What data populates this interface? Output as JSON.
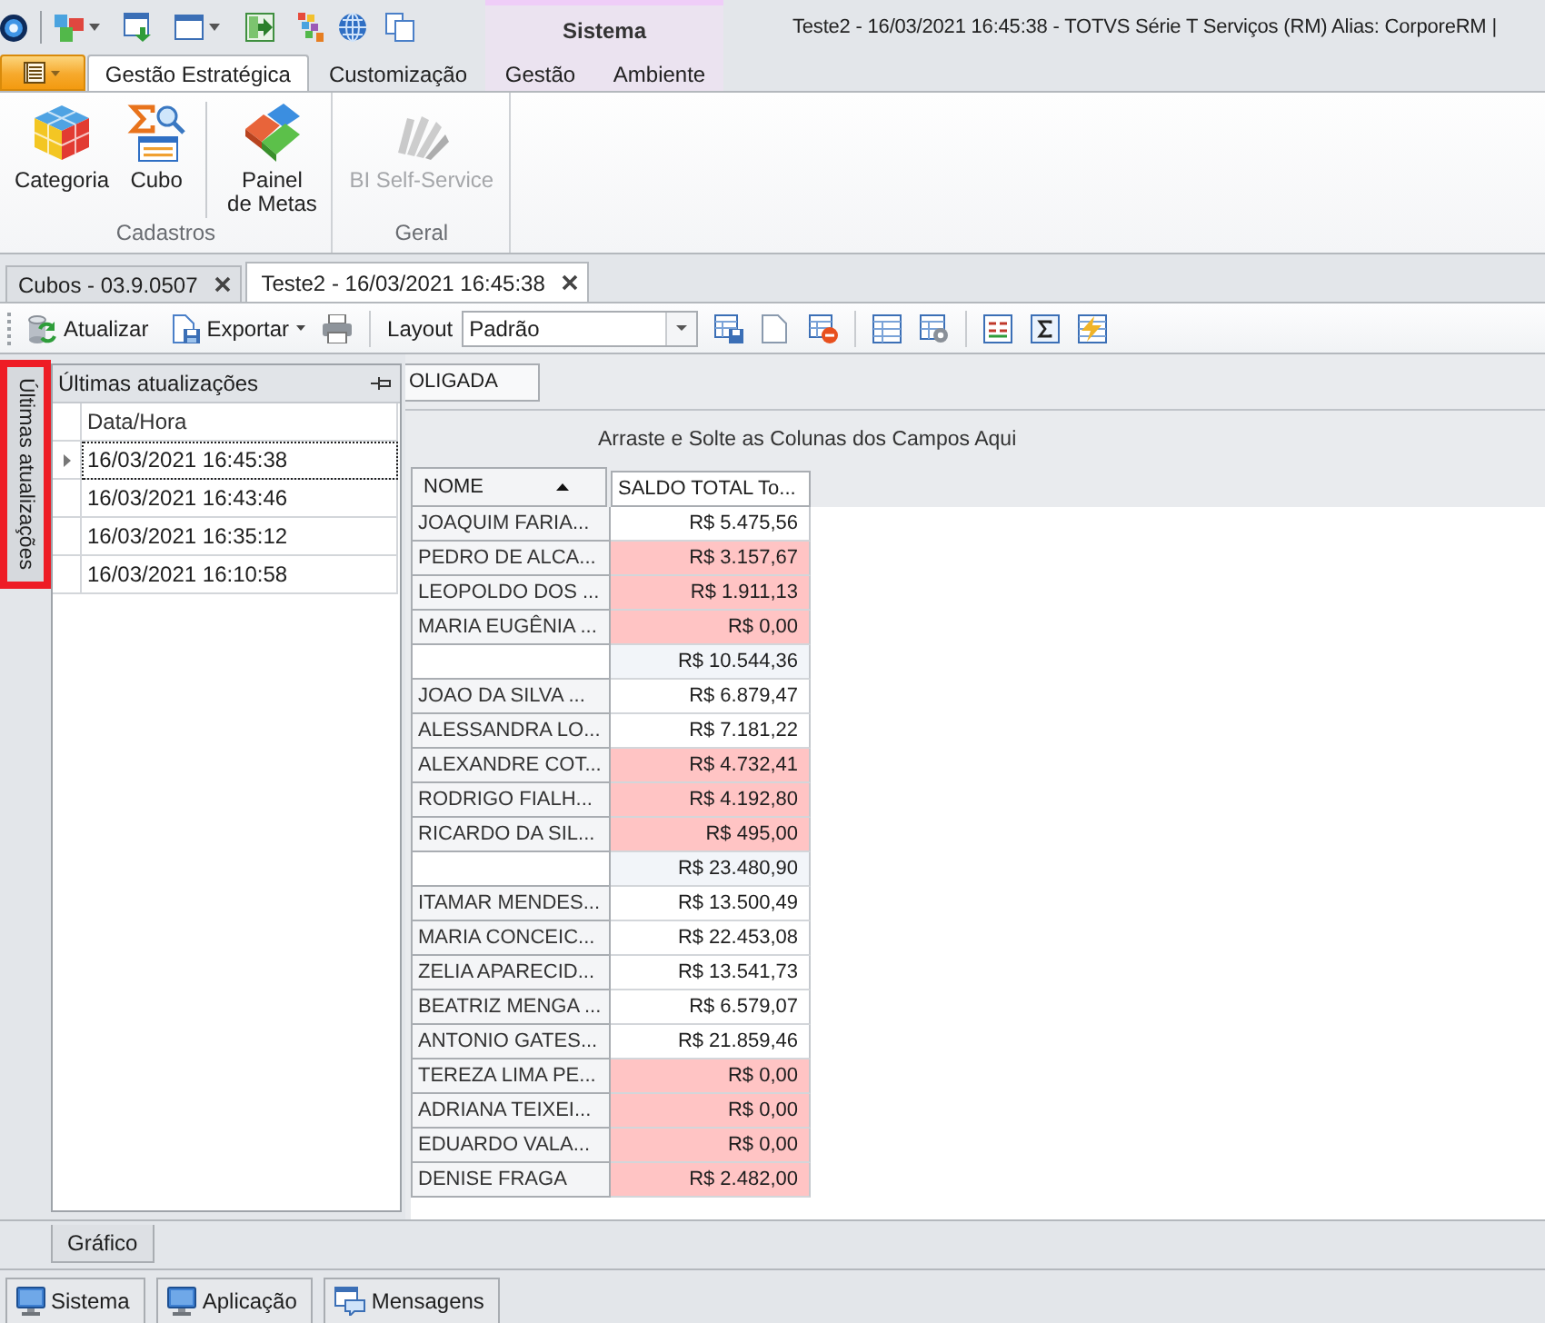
{
  "window": {
    "title": "Teste2 - 16/03/2021 16:45:38 - TOTVS Série T Serviços (RM) Alias: CorporeRM |"
  },
  "ribbon_tabs": [
    {
      "label": "Gestão Estratégica",
      "selected": true
    },
    {
      "label": "Customização",
      "selected": false
    }
  ],
  "contextual_group": {
    "title": "Sistema",
    "tabs": [
      {
        "label": "Gestão",
        "selected": false
      },
      {
        "label": "Ambiente",
        "selected": false
      }
    ]
  },
  "ribbon_groups": [
    {
      "label": "Cadastros",
      "buttons": [
        {
          "label": "Categoria",
          "disabled": false,
          "separator_before": false
        },
        {
          "label": "Cubo",
          "disabled": false,
          "separator_before": false
        },
        {
          "label": "Painel\nde Metas",
          "disabled": false,
          "separator_before": true
        }
      ]
    },
    {
      "label": "Geral",
      "buttons": [
        {
          "label": "BI Self-Service",
          "disabled": true,
          "separator_before": false
        }
      ]
    }
  ],
  "document_tabs": [
    {
      "label": "Cubos - 03.9.0507",
      "selected": false
    },
    {
      "label": "Teste2 - 16/03/2021 16:45:38",
      "selected": true
    }
  ],
  "toolbar": {
    "buttons": [
      {
        "label": "Atualizar",
        "dropdown": false
      },
      {
        "label": "Exportar",
        "dropdown": true
      }
    ],
    "layout": {
      "label": "Layout",
      "value": "Padrão"
    }
  },
  "side_tab": {
    "label": "Últimas atualizações",
    "highlighted": true
  },
  "updates_panel": {
    "title": "Últimas atualizações",
    "column": "Data/Hora",
    "rows": [
      {
        "value": "16/03/2021 16:45:38",
        "selected": true
      },
      {
        "value": "16/03/2021 16:43:46",
        "selected": false
      },
      {
        "value": "16/03/2021 16:35:12",
        "selected": false
      },
      {
        "value": "16/03/2021 16:10:58",
        "selected": false
      }
    ]
  },
  "pivot": {
    "filter_fields": [
      {
        "label": "OLIGADA"
      }
    ],
    "column_area_hint": "Arraste e Solte as Colunas dos Campos Aqui",
    "row_field": {
      "label": "NOME",
      "sorted_ascending": true
    },
    "data_header": "SALDO TOTAL To...",
    "rows": [
      {
        "kind": "item",
        "name": "JOAQUIM FARIA...",
        "value": "R$ 5.475,56",
        "highlighted": false
      },
      {
        "kind": "item",
        "name": "PEDRO DE ALCA...",
        "value": "R$ 3.157,67",
        "highlighted": true
      },
      {
        "kind": "item",
        "name": "LEOPOLDO DOS ...",
        "value": "R$ 1.911,13",
        "highlighted": true
      },
      {
        "kind": "item",
        "name": "MARIA EUGÊNIA ...",
        "value": "R$ 0,00",
        "highlighted": true
      },
      {
        "kind": "total",
        "value": "R$ 10.544,36"
      },
      {
        "kind": "item",
        "name": "JOAO DA SILVA ...",
        "value": "R$ 6.879,47",
        "highlighted": false
      },
      {
        "kind": "item",
        "name": "ALESSANDRA LO...",
        "value": "R$ 7.181,22",
        "highlighted": false
      },
      {
        "kind": "item",
        "name": "ALEXANDRE COT...",
        "value": "R$ 4.732,41",
        "highlighted": true
      },
      {
        "kind": "item",
        "name": "RODRIGO FIALH...",
        "value": "R$ 4.192,80",
        "highlighted": true
      },
      {
        "kind": "item",
        "name": "RICARDO DA SIL...",
        "value": "R$ 495,00",
        "highlighted": true
      },
      {
        "kind": "total",
        "value": "R$ 23.480,90"
      },
      {
        "kind": "item",
        "name": "ITAMAR MENDES...",
        "value": "R$ 13.500,49",
        "highlighted": false
      },
      {
        "kind": "item",
        "name": "MARIA CONCEIC...",
        "value": "R$ 22.453,08",
        "highlighted": false
      },
      {
        "kind": "item",
        "name": "ZELIA APARECID...",
        "value": "R$ 13.541,73",
        "highlighted": false
      },
      {
        "kind": "item",
        "name": "BEATRIZ MENGA ...",
        "value": "R$ 6.579,07",
        "highlighted": false
      },
      {
        "kind": "item",
        "name": "ANTONIO GATES...",
        "value": "R$ 21.859,46",
        "highlighted": false
      },
      {
        "kind": "item",
        "name": "TEREZA LIMA PE...",
        "value": "R$ 0,00",
        "highlighted": true
      },
      {
        "kind": "item",
        "name": "ADRIANA TEIXEI...",
        "value": "R$ 0,00",
        "highlighted": true
      },
      {
        "kind": "item",
        "name": "EDUARDO VALA...",
        "value": "R$ 0,00",
        "highlighted": true
      },
      {
        "kind": "item",
        "name": "DENISE FRAGA",
        "value": "R$ 2.482,00",
        "highlighted": true
      }
    ]
  },
  "bottom_tabs": [
    {
      "label": "Gráfico"
    }
  ],
  "status_bar": {
    "buttons": [
      {
        "label": "Sistema"
      },
      {
        "label": "Aplicação"
      },
      {
        "label": "Mensagens"
      }
    ]
  }
}
